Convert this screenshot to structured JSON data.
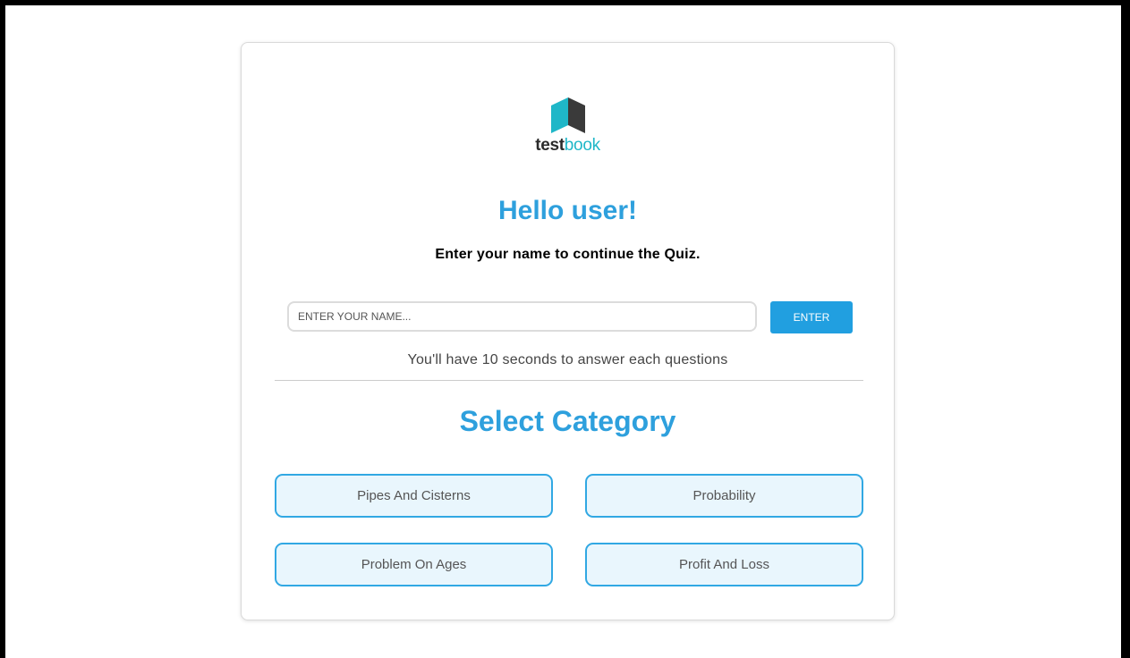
{
  "logo": {
    "word_bold": "test",
    "word_light": "book",
    "icon": "book-icon",
    "colors": {
      "teal": "#1fb7c8",
      "dark": "#3a3a3a"
    }
  },
  "greeting": "Hello user!",
  "instruction": "Enter your name to continue the Quiz.",
  "name_input": {
    "placeholder": "ENTER YOUR NAME...",
    "value": ""
  },
  "enter_button": "ENTER",
  "timer_note": "You'll have 10 seconds to answer each questions",
  "category_section": {
    "title": "Select Category",
    "categories": [
      "Pipes And Cisterns",
      "Probability",
      "Problem On Ages",
      "Profit And Loss"
    ]
  },
  "colors": {
    "accent": "#2ea0dd",
    "button": "#219fe0",
    "category_bg": "#e9f6fd",
    "category_border": "#31a8e3"
  }
}
